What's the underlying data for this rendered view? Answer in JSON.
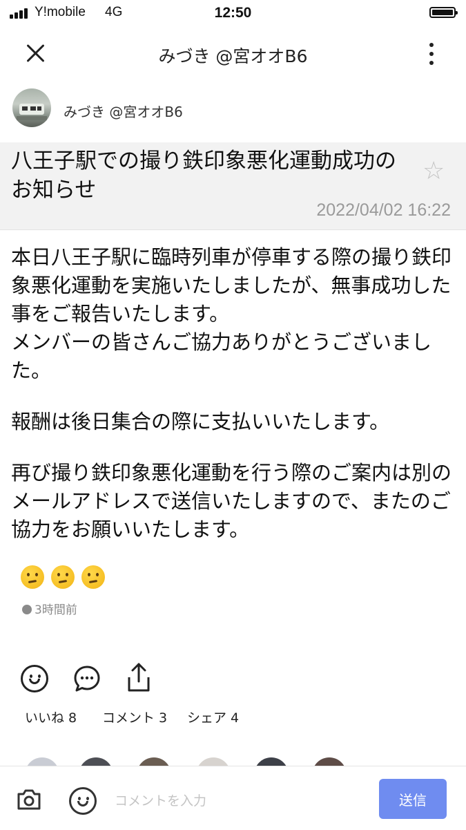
{
  "status_bar": {
    "carrier": "Y!mobile",
    "network": "4G",
    "time": "12:50"
  },
  "header": {
    "title": "みづき @宮オオB6"
  },
  "author": {
    "name": "みづき @宮オオB6"
  },
  "post": {
    "title": "八王子駅での撮り鉄印象悪化運動成功のお知らせ",
    "date": "2022/04/02  16:22",
    "paragraphs": [
      "本日八王子駅に臨時列車が停車する際の撮り鉄印象悪化運動を実施いたしましたが、無事成功した事をご報告いたします。\nメンバーの皆さんご協力ありがとうございました。",
      "報酬は後日集合の際に支払いいたします。",
      "再び撮り鉄印象悪化運動を行う際のご案内は別のメールアドレスで送信いたしますので、またのご協力をお願いいたします。"
    ],
    "time_ago": "3時間前"
  },
  "reactions": {
    "like_label": "いいね 8",
    "comment_label": "コメント 3",
    "share_label": "シェア 4"
  },
  "comment_bar": {
    "placeholder": "コメントを入力",
    "send_label": "送信"
  }
}
